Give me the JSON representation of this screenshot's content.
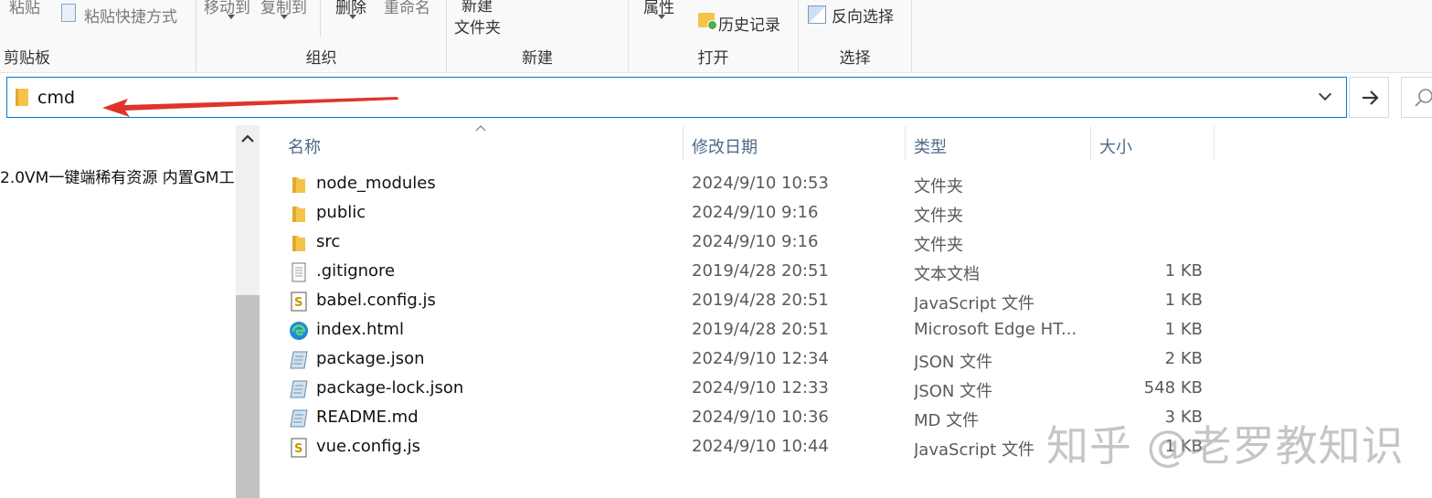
{
  "ribbon": {
    "clipboard": {
      "label": "剪贴板",
      "paste": "粘贴",
      "paste_shortcut": "粘贴快捷方式"
    },
    "organize": {
      "label": "组织",
      "move_to": "移动到",
      "copy_to": "复制到",
      "delete": "删除",
      "rename": "重命名"
    },
    "new": {
      "label": "新建",
      "new_top": "新建",
      "new_folder": "文件夹"
    },
    "open": {
      "label": "打开",
      "properties": "属性",
      "history": "历史记录"
    },
    "select": {
      "label": "选择",
      "invert": "反向选择"
    }
  },
  "address": {
    "path": "cmd"
  },
  "nav": {
    "item": "2.0VM一键端稀有资源 内置GM工"
  },
  "columns": {
    "name": "名称",
    "date": "修改日期",
    "type": "类型",
    "size": "大小"
  },
  "files": [
    {
      "name": "node_modules",
      "date": "2024/9/10 10:53",
      "type": "文件夹",
      "size": "",
      "icon": "folder"
    },
    {
      "name": "public",
      "date": "2024/9/10 9:16",
      "type": "文件夹",
      "size": "",
      "icon": "folder"
    },
    {
      "name": "src",
      "date": "2024/9/10 9:16",
      "type": "文件夹",
      "size": "",
      "icon": "folder"
    },
    {
      "name": ".gitignore",
      "date": "2019/4/28 20:51",
      "type": "文本文档",
      "size": "1 KB",
      "icon": "text"
    },
    {
      "name": "babel.config.js",
      "date": "2019/4/28 20:51",
      "type": "JavaScript 文件",
      "size": "1 KB",
      "icon": "js"
    },
    {
      "name": "index.html",
      "date": "2019/4/28 20:51",
      "type": "Microsoft Edge HT...",
      "size": "1 KB",
      "icon": "edge"
    },
    {
      "name": "package.json",
      "date": "2024/9/10 12:34",
      "type": "JSON 文件",
      "size": "2 KB",
      "icon": "json"
    },
    {
      "name": "package-lock.json",
      "date": "2024/9/10 12:33",
      "type": "JSON 文件",
      "size": "548 KB",
      "icon": "json"
    },
    {
      "name": "README.md",
      "date": "2024/9/10 10:36",
      "type": "MD 文件",
      "size": "3 KB",
      "icon": "json"
    },
    {
      "name": "vue.config.js",
      "date": "2024/9/10 10:44",
      "type": "JavaScript 文件",
      "size": "1 KB",
      "icon": "js"
    }
  ],
  "watermark": "知乎 @老罗教知识",
  "colors": {
    "accent": "#0078d7",
    "folder": "#f5c34b",
    "arrow": "#e0342b",
    "header_text": "#4d6a8a"
  }
}
